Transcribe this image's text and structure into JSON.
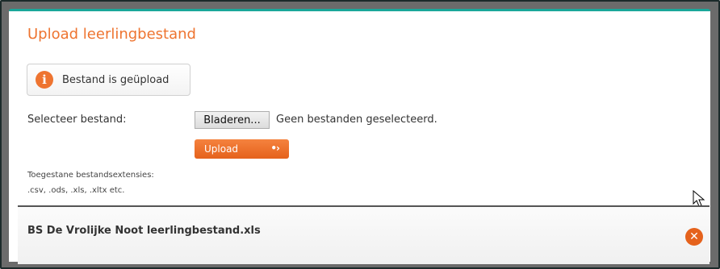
{
  "header": {
    "title": "Upload leerlingbestand"
  },
  "notice": {
    "text": "Bestand is geüpload",
    "icon": "info-icon",
    "color": "#ee7430"
  },
  "file_select": {
    "label": "Selecteer bestand:",
    "browse_label": "Bladeren...",
    "status": "Geen bestanden geselecteerd."
  },
  "upload": {
    "label": "Upload",
    "icon": "arrow-right-icon",
    "color": "#ee7430"
  },
  "extensions": {
    "title": "Toegestane bestandsextensies:",
    "list": ".csv, .ods, .xls, .xltx etc."
  },
  "uploaded_file": {
    "name": "BS De Vrolijke Noot leerlingbestand.xls",
    "delete_icon": "close-icon"
  },
  "theme": {
    "accent": "#ee7430",
    "top_border": "#1aa79a"
  }
}
